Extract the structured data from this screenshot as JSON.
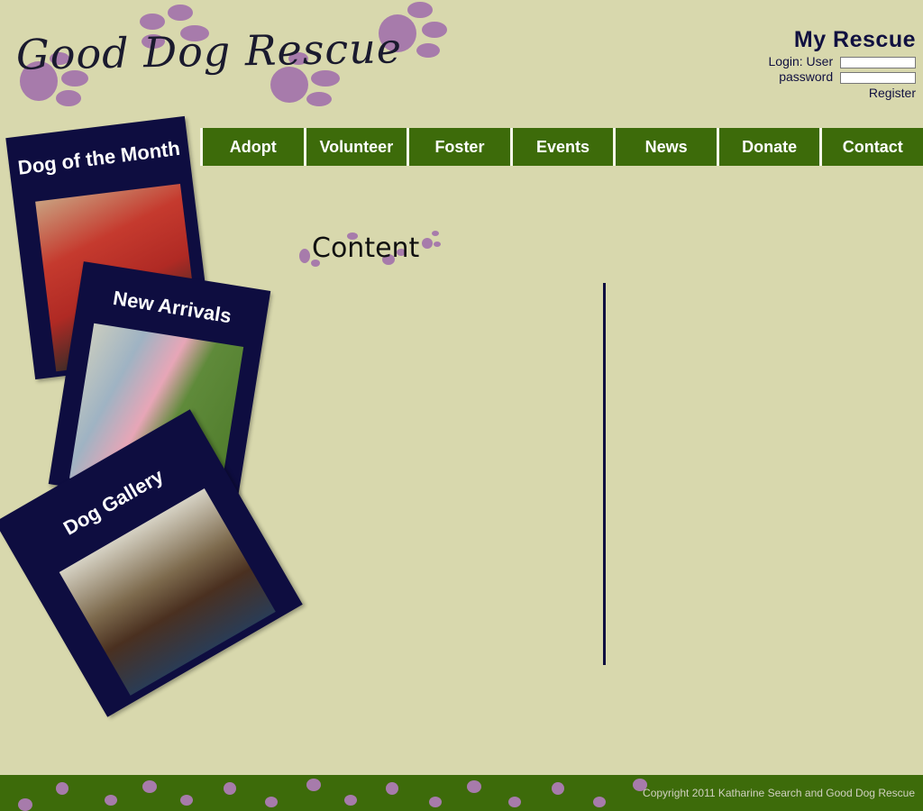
{
  "header": {
    "logo_text": "Good Dog Rescue",
    "account": {
      "title": "My Rescue",
      "login_label": "Login:",
      "user_label": "User",
      "password_label": "password",
      "register_label": "Register",
      "user_value": "",
      "password_value": ""
    }
  },
  "nav": {
    "items": [
      "Adopt",
      "Volunteer",
      "Foster",
      "Events",
      "News",
      "Donate",
      "Contact"
    ]
  },
  "sidebar": {
    "cards": [
      {
        "label": "Dog of the Month"
      },
      {
        "label": "New Arrivals"
      },
      {
        "label": "Dog Gallery"
      }
    ]
  },
  "main": {
    "title": "Content"
  },
  "footer": {
    "copyright": "Copyright 2011 Katharine Search and Good Dog Rescue"
  },
  "colors": {
    "background": "#d8d8ad",
    "nav_green": "#3d6b0a",
    "navy": "#0e0d40",
    "paw_purple": "#a77bab"
  }
}
